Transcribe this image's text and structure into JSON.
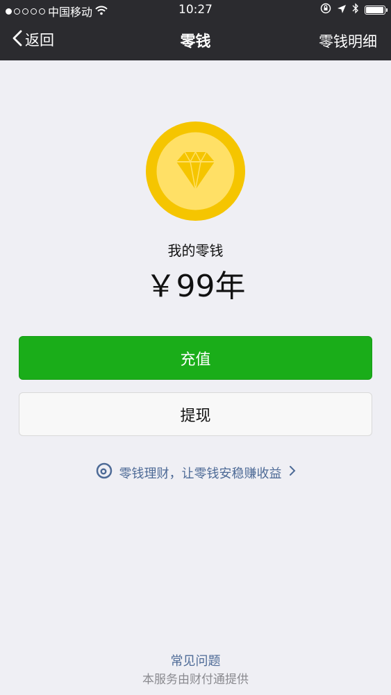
{
  "status_bar": {
    "carrier": "中国移动",
    "time": "10:27",
    "signal_dots_filled": 1,
    "signal_dots_total": 5
  },
  "nav": {
    "back_label": "返回",
    "title": "零钱",
    "right_label": "零钱明细"
  },
  "balance": {
    "label": "我的零钱",
    "amount": "￥99年"
  },
  "actions": {
    "recharge_label": "充值",
    "withdraw_label": "提现"
  },
  "promo": {
    "text": "零钱理财，让零钱安稳赚收益"
  },
  "footer": {
    "faq_label": "常见问题",
    "provider_text": "本服务由财付通提供"
  },
  "colors": {
    "nav_bg": "#2b2b2f",
    "page_bg": "#efeff4",
    "primary_green": "#1aad19",
    "link_blue": "#4d6a96",
    "coin_outer": "#f5c500",
    "coin_inner": "#ffe066"
  }
}
